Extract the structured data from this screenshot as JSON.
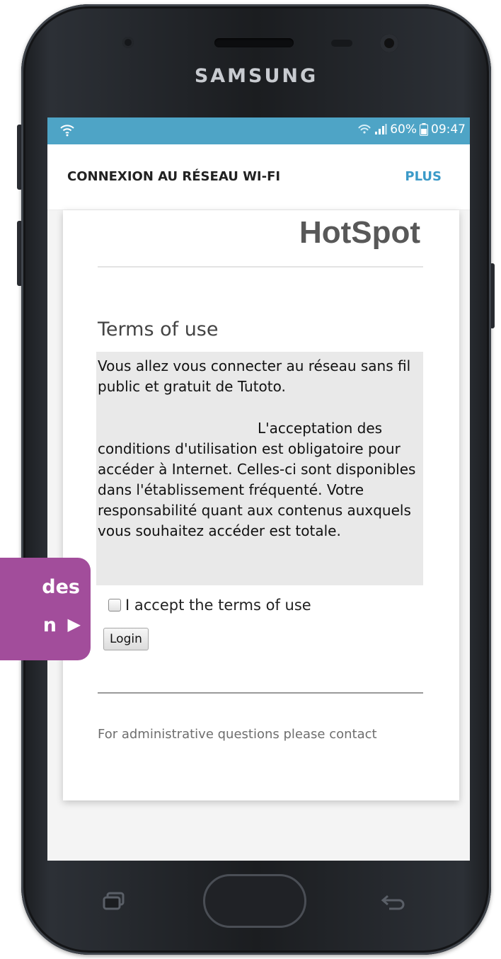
{
  "device": {
    "brand": "SAMSUNG"
  },
  "status_bar": {
    "battery": "60%",
    "time": "09:47"
  },
  "app_bar": {
    "title": "CONNEXION AU RÉSEAU WI-FI",
    "more_label": "PLUS"
  },
  "portal": {
    "title": "HotSpot",
    "terms_heading": "Terms of use",
    "terms_paragraph_1": "Vous allez vous connecter au réseau sans fil public et gratuit de Tutoto.",
    "terms_paragraph_2": "L'acceptation des conditions d'utilisation est obligatoire pour accéder à Internet. Celles-ci sont disponibles dans l'établissement fréquenté. Votre responsabilité quant aux contenus auxquels vous souhaitez accéder est totale.",
    "accept_label": "I accept the terms of use",
    "accept_checked": false,
    "login_label": "Login",
    "admin_note": "For administrative questions please contact"
  },
  "callout": {
    "line1": "des",
    "line2": "n",
    "arrow": "▶",
    "color": "#a24d9b"
  },
  "colors": {
    "status_bar": "#4ea4c6",
    "accent": "#3b9ac8"
  },
  "icons": [
    "wifi-icon",
    "signal-icon",
    "battery-icon",
    "recent-apps-icon",
    "home-button",
    "back-icon"
  ]
}
